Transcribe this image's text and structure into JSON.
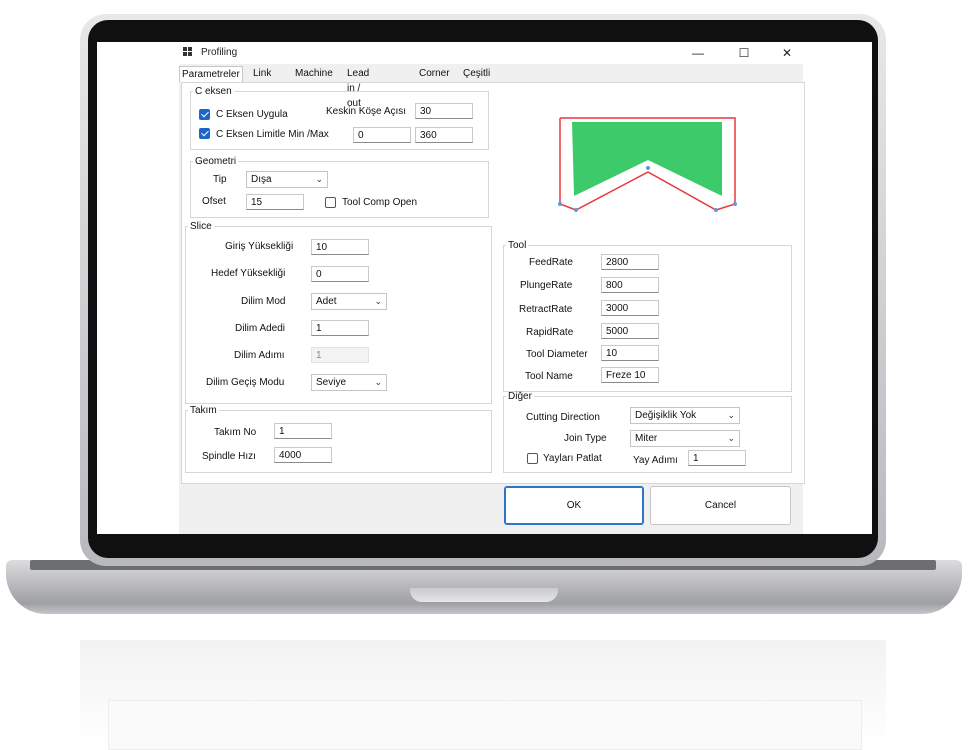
{
  "window": {
    "title": "Profiling",
    "minimize": "—",
    "maximize": "☐",
    "close": "✕"
  },
  "tabs": [
    "Parametreler",
    "Link",
    "Machine",
    "Lead in / out",
    "Corner",
    "Çeşitli"
  ],
  "c_eksen": {
    "legend": "C eksen",
    "uygula_label": "C Eksen Uygula",
    "uygula_checked": true,
    "limitle_label": "C Eksen Limitle Min /Max",
    "limitle_checked": true,
    "kose_label": "Keskin Köşe Açısı",
    "kose_value": "30",
    "min_value": "0",
    "max_value": "360"
  },
  "geometri": {
    "legend": "Geometri",
    "tip_label": "Tip",
    "tip_value": "Dışa",
    "ofset_label": "Ofset",
    "ofset_value": "15",
    "tool_comp_label": "Tool Comp Open",
    "tool_comp_checked": false
  },
  "slice": {
    "legend": "Slice",
    "giris_label": "Giriş Yüksekliği",
    "giris_value": "10",
    "hedef_label": "Hedef Yüksekliği",
    "hedef_value": "0",
    "mod_label": "Dilim Mod",
    "mod_value": "Adet",
    "adedi_label": "Dilim Adedi",
    "adedi_value": "1",
    "adimi_label": "Dilim Adımı",
    "adimi_value": "1",
    "gecis_label": "Dilim Geçiş Modu",
    "gecis_value": "Seviye"
  },
  "takim": {
    "legend": "Takım",
    "no_label": "Takım No",
    "no_value": "1",
    "spindle_label": "Spindle Hızı",
    "spindle_value": "4000"
  },
  "tool": {
    "legend": "Tool",
    "feed_label": "FeedRate",
    "feed_value": "2800",
    "plunge_label": "PlungeRate",
    "plunge_value": "800",
    "retract_label": "RetractRate",
    "retract_value": "3000",
    "rapid_label": "RapidRate",
    "rapid_value": "5000",
    "diameter_label": "Tool Diameter",
    "diameter_value": "10",
    "name_label": "Tool Name",
    "name_value": "Freze 10"
  },
  "diger": {
    "legend": "Diğer",
    "cutting_label": "Cutting Direction",
    "cutting_value": "Değişiklik Yok",
    "join_label": "Join Type",
    "join_value": "Miter",
    "yay_label": "Yayları Patlat",
    "yay_checked": false,
    "yay_adimi_label": "Yay Adımı",
    "yay_adimi_value": "1"
  },
  "buttons": {
    "ok": "OK",
    "cancel": "Cancel"
  },
  "preview": {
    "fill": "#3dca6a",
    "outline": "#e8393e",
    "vertex": "#5b9bdc"
  }
}
